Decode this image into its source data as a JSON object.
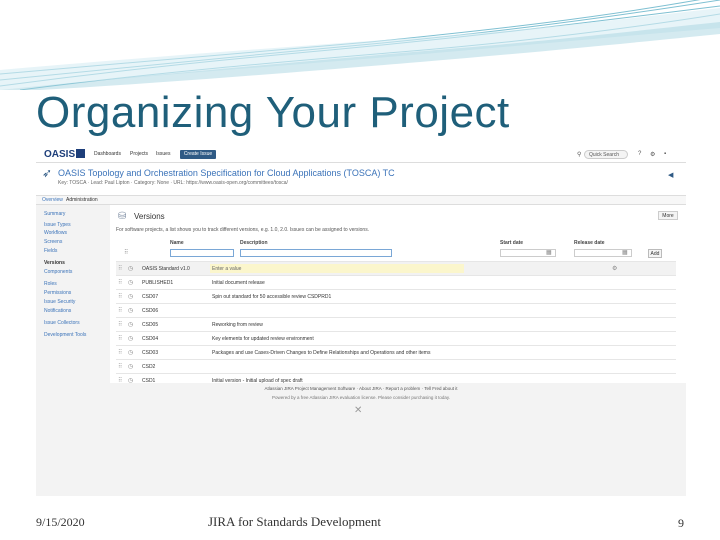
{
  "slide": {
    "title": "Organizing Your Project",
    "footer_date": "9/15/2020",
    "footer_center": "JIRA for Standards Development",
    "page_number": "9"
  },
  "colors": {
    "title": "#1f5f7a",
    "wave": "#6fb3c8",
    "jira_blue": "#2f5a85",
    "link": "#3b73b9"
  },
  "jira": {
    "logo_text": "OASIS",
    "nav": [
      "Dashboards",
      "Projects",
      "Issues"
    ],
    "create_label": "Create Issue",
    "search_placeholder": "Quick Search",
    "project": {
      "title": "OASIS Topology and Orchestration Specification for Cloud Applications (TOSCA) TC",
      "meta": "Key: TOSCA · Lead: Paul Lipton · Category: None · URL: https://www.oasis-open.org/committees/tosca/"
    },
    "tabs": [
      "Overview",
      "Administration"
    ],
    "sidebar": [
      "Summary",
      "Issue Types",
      "Workflows",
      "Screens",
      "Fields",
      "Versions",
      "Components",
      "Roles",
      "Permissions",
      "Issue Security",
      "Notifications",
      "Issue Collectors",
      "Development Tools"
    ],
    "versions": {
      "heading": "Versions",
      "more_label": "More",
      "description": "For software projects, a list shows you to track different versions, e.g. 1.0, 2.0. Issues can be assigned to versions.",
      "columns": [
        "Name",
        "Description",
        "Start date",
        "Release date"
      ],
      "add_label": "Add",
      "rows": [
        {
          "name": "OASIS Standard v1.0",
          "description": "Enter a value",
          "editing": true
        },
        {
          "name": "PUBLISHED1",
          "description": "Initial document release"
        },
        {
          "name": "CSD07",
          "description": "Spin out standard for 50 accessible review CSDPRD1"
        },
        {
          "name": "CSD06",
          "description": ""
        },
        {
          "name": "CSD05",
          "description": "Reworking from review"
        },
        {
          "name": "CSD04",
          "description": "Key elements for updated review environment"
        },
        {
          "name": "CSD03",
          "description": "Packages and use Cases-Driven Changes to Define Relationships and Operations and other items"
        },
        {
          "name": "CSD2",
          "description": ""
        },
        {
          "name": "CSD1",
          "description": "Initial version - Initial upload of spec draft"
        }
      ]
    },
    "footer": {
      "line1": "Atlassian JIRA Project Management Software · About JIRA · Report a problem · Tell Fred about it",
      "line2": "Powered by a free Atlassian JIRA evaluation license. Please consider purchasing it today."
    }
  }
}
